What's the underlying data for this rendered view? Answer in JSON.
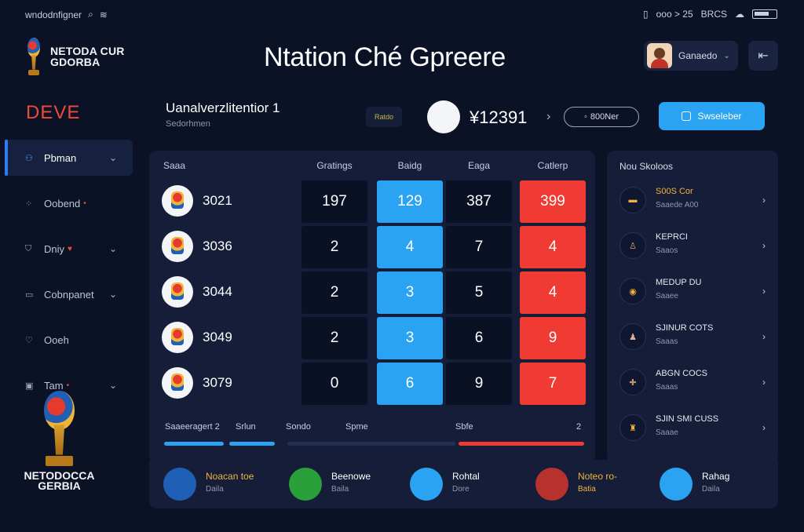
{
  "statusbar": {
    "left_text": "wndodnfigner",
    "right_text": "ooo > 25",
    "right_label": "BRCS"
  },
  "brand": {
    "line1": "NETODA CUR",
    "line2": "GDORBA"
  },
  "title": "Ntation Ché Gpreere",
  "user": {
    "name": "Ganaedo"
  },
  "sidebar": {
    "heading": "DEVE",
    "items": [
      {
        "label": "Pbman",
        "active": true,
        "icon": "people-icon"
      },
      {
        "label": "Oobend",
        "dot": true,
        "icon": "scatter-icon"
      },
      {
        "label": "Dniy",
        "dot": true,
        "icon": "shield-icon"
      },
      {
        "label": "Cobnpanet",
        "icon": "calendar-icon"
      },
      {
        "label": "Ooeh",
        "icon": "heart-icon"
      },
      {
        "label": "Tam",
        "dot": true,
        "icon": "card-icon"
      }
    ]
  },
  "big_brand": {
    "line1": "NETODOCCA",
    "line2": "GERBIA"
  },
  "summary": {
    "title": "Uanalverzlitentior 1",
    "subtitle": "Sedorhmen",
    "tag": "Ratdo",
    "total": "¥12391",
    "pill_label": "800Ner",
    "cta_label": "Swseleber"
  },
  "table": {
    "headers": [
      "Saaa",
      "Gratings",
      "Baidg",
      "Eaga",
      "Catlerp"
    ],
    "rows": [
      {
        "score": "3021",
        "c1": "197",
        "c2": "129",
        "c3": "387",
        "c4": "399"
      },
      {
        "score": "3036",
        "c1": "2",
        "c2": "4",
        "c3": "7",
        "c4": "4"
      },
      {
        "score": "3044",
        "c1": "2",
        "c2": "3",
        "c3": "5",
        "c4": "4"
      },
      {
        "score": "3049",
        "c1": "2",
        "c2": "3",
        "c3": "6",
        "c4": "9"
      },
      {
        "score": "3079",
        "c1": "0",
        "c2": "6",
        "c3": "9",
        "c4": "7"
      }
    ],
    "legend": [
      "Saaeeragert 2",
      "Srlun",
      "Sondo",
      "Spme",
      "Sbfe",
      "2"
    ],
    "progress": {
      "blue_pct": 80,
      "red_pct": 100
    }
  },
  "side": {
    "title": "Nou Skoloos",
    "items": [
      {
        "title": "S00S Cor",
        "sub": "Saaede A00",
        "highlight": true
      },
      {
        "title": "KEPRCI",
        "sub": "Saaos"
      },
      {
        "title": "MEDUP DU",
        "sub": "Saaee"
      },
      {
        "title": "SJINUR COTS",
        "sub": "Saaas"
      },
      {
        "title": "ABGN COCS",
        "sub": "Saaas"
      },
      {
        "title": "SJIN SMI CUSS",
        "sub": "Saaae"
      }
    ]
  },
  "footer": [
    {
      "title": "Noacan toe",
      "sub": "Daila",
      "accent": "#f0b43a",
      "icon_color": "#1f5fb5"
    },
    {
      "title": "Beenowe",
      "sub": "Baila",
      "accent": "#ffffff",
      "icon_color": "#2aa03a"
    },
    {
      "title": "Rohtal",
      "sub": "Dore",
      "accent": "#ffffff",
      "icon_color": "#2aa3f2"
    },
    {
      "title": "Noteo ro-",
      "sub": "Batia",
      "accent": "#f0b43a",
      "icon_color": "#b8322d"
    },
    {
      "title": "Rahag",
      "sub": "Daila",
      "accent": "#ffffff",
      "icon_color": "#2aa3f2"
    }
  ]
}
